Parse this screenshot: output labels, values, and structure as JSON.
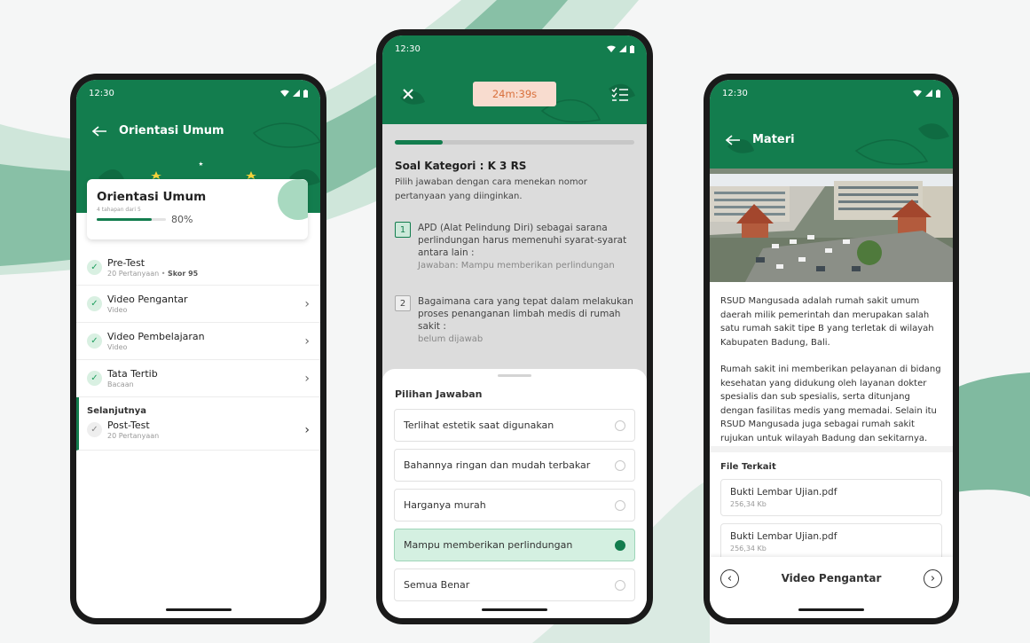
{
  "status": {
    "time": "12:30"
  },
  "phone1": {
    "title": "Orientasi Umum",
    "card": {
      "title": "Orientasi Umum",
      "steps": "4 tahapan dari 5",
      "percent": "80%",
      "progress": 0.8
    },
    "items": [
      {
        "title": "Pre-Test",
        "sub": "20 Pertanyaan",
        "score": "Skor 95"
      },
      {
        "title": "Video Pengantar",
        "sub": "Video"
      },
      {
        "title": "Video Pembelajaran",
        "sub": "Video"
      },
      {
        "title": "Tata Tertib",
        "sub": "Bacaan"
      }
    ],
    "next_label": "Selanjutnya",
    "next_item": {
      "title": "Post-Test",
      "sub": "20 Pertanyaan"
    }
  },
  "phone2": {
    "timer": "24m:39s",
    "progress": 0.2,
    "category": "Soal Kategori : K 3 RS",
    "instruction": "Pilih jawaban dengan cara menekan nomor pertanyaan yang diinginkan.",
    "questions": [
      {
        "number": "1",
        "text": "APD (Alat Pelindung Diri) sebagai sarana perlindungan harus memenuhi syarat-syarat antara lain :",
        "answer": "Jawaban: Mampu memberikan perlindungan"
      },
      {
        "number": "2",
        "text": "Bagaimana cara yang tepat dalam melakukan proses penanganan limbah medis di rumah sakit :",
        "answer": "belum dijawab"
      }
    ],
    "sheet_title": "Pilihan Jawaban",
    "options": [
      {
        "label": "Terlihat estetik saat digunakan"
      },
      {
        "label": "Bahannya ringan dan mudah terbakar"
      },
      {
        "label": "Harganya murah"
      },
      {
        "label": "Mampu memberikan perlindungan"
      },
      {
        "label": "Semua Benar"
      }
    ],
    "selected_option": "Mampu memberikan perlindungan"
  },
  "phone3": {
    "title": "Materi",
    "para1": "RSUD Mangusada adalah rumah sakit umum daerah milik pemerintah dan merupakan salah satu rumah sakit tipe B yang terletak di wilayah Kabupaten Badung, Bali.",
    "para2": "Rumah sakit ini memberikan pelayanan di bidang kesehatan yang didukung oleh layanan dokter spesialis dan sub spesialis, serta ditunjang dengan fasilitas medis yang memadai. Selain itu RSUD Mangusada juga sebagai rumah sakit rujukan untuk wilayah Badung dan sekitarnya.",
    "files_title": "File Terkait",
    "files": [
      {
        "name": "Bukti Lembar Ujian.pdf",
        "size": "256,34 Kb"
      },
      {
        "name": "Bukti Lembar Ujian.pdf",
        "size": "256,34 Kb"
      }
    ],
    "nav_label": "Video Pengantar"
  },
  "colors": {
    "brand": "#137d4e",
    "accent": "#1e9e5e",
    "timer_bg": "#f8dccf",
    "timer_text": "#d9703c"
  }
}
